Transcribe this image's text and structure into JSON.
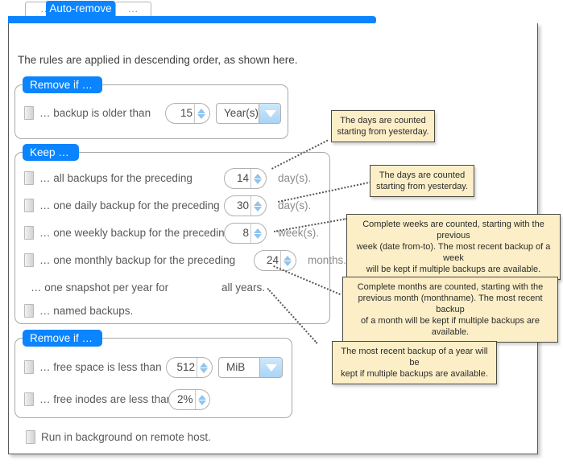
{
  "tabs": {
    "left_label": "...",
    "active_label": "Auto-remove",
    "right_label": "..."
  },
  "intro": "The rules are applied in descending order, as shown here.",
  "groups": {
    "remove_age": {
      "label": "Remove if …",
      "rows": [
        {
          "label": "… backup is older than",
          "value": "15",
          "unit_select": "Year(s)"
        }
      ]
    },
    "keep": {
      "label": "Keep …",
      "rows": [
        {
          "label": "… all backups for the preceding",
          "value": "14",
          "unit": "day(s)."
        },
        {
          "label": "… one daily backup for the preceding",
          "value": "30",
          "unit": "day(s)."
        },
        {
          "label": "… one weekly backup for the preceding",
          "value": "8",
          "unit": "week(s)."
        },
        {
          "label": "… one monthly backup for the preceding",
          "value": "24",
          "unit": "months."
        }
      ],
      "snapshot_label": "… one snapshot per year for",
      "snapshot_value": "all years.",
      "named_label": "… named backups."
    },
    "remove_space": {
      "label": "Remove if …",
      "rows": [
        {
          "label": "… free space is less than",
          "value": "512",
          "unit_select": "MiB"
        },
        {
          "label": "… free inodes are less than",
          "value": "2%"
        }
      ]
    }
  },
  "run_background_label": "Run in background on remote host.",
  "callouts": {
    "days1": [
      "The days are counted",
      "starting from yesterday."
    ],
    "days2": [
      "The days are counted",
      "starting from yesterday."
    ],
    "weeks": [
      "Complete weeks are counted, starting with the previous",
      "week (date from-to). The most recent backup of a week",
      "will be kept if multiple backups are available."
    ],
    "months": [
      "Complete months are counted, starting with the",
      "previous month (monthname). The most recent backup",
      "of a month will be kept if multiple backups are available."
    ],
    "years": [
      "The most recent backup of a year will be",
      "kept if multiple backups are available."
    ]
  },
  "colors": {
    "accent": "#0a84ff",
    "callout_bg": "#fcefc7",
    "callout_border": "#4a4a42",
    "spinner_arrow": "#8fc4ee"
  }
}
